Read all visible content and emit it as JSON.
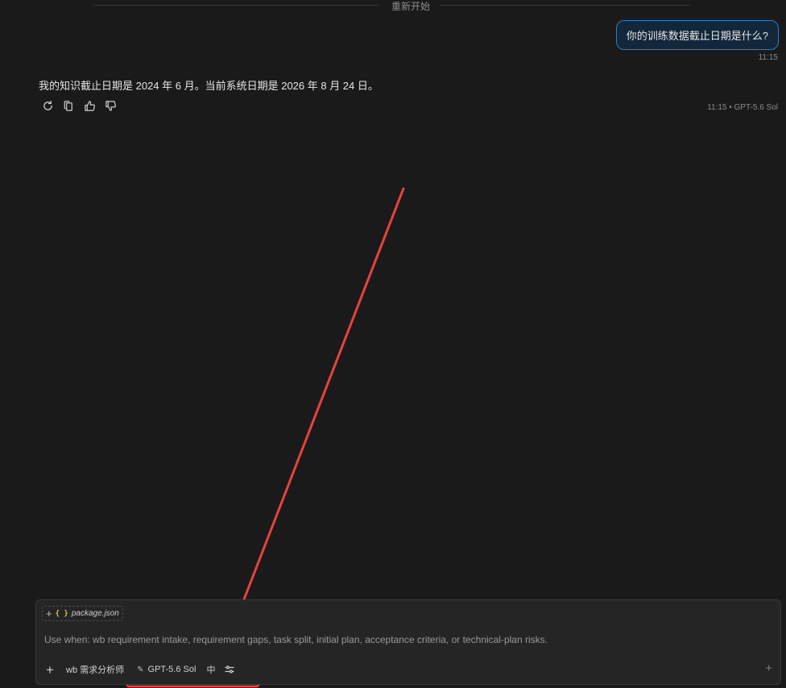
{
  "divider": {
    "label": "重新开始"
  },
  "user_message": {
    "text": "你的训练数据截止日期是什么?",
    "time": "11:15"
  },
  "assistant_message": {
    "text": "我的知识截止日期是 2024 年 6 月。当前系统日期是 2026 年 8 月 24 日。",
    "meta": "11:15 • GPT-5.6 Sol",
    "actions": [
      {
        "name": "retry-icon"
      },
      {
        "name": "copy-icon"
      },
      {
        "name": "thumbs-up-icon"
      },
      {
        "name": "thumbs-down-icon"
      }
    ]
  },
  "composer": {
    "context_chip": {
      "braces": "{ }",
      "file": "package.json"
    },
    "placeholder": "Use when: wb requirement intake, requirement gaps, task split, initial plan, acceptance criteria, or technical-plan risks.",
    "toolbar": {
      "add_label": "+",
      "agent": "wb 需求分析师",
      "model": "GPT-5.6 Sol",
      "effort": "中"
    }
  },
  "colors": {
    "background": "#1b1a1b",
    "user_bubble_border": "#2e7bc2",
    "annotation": "#e5443c",
    "braces": "#e2c044"
  }
}
